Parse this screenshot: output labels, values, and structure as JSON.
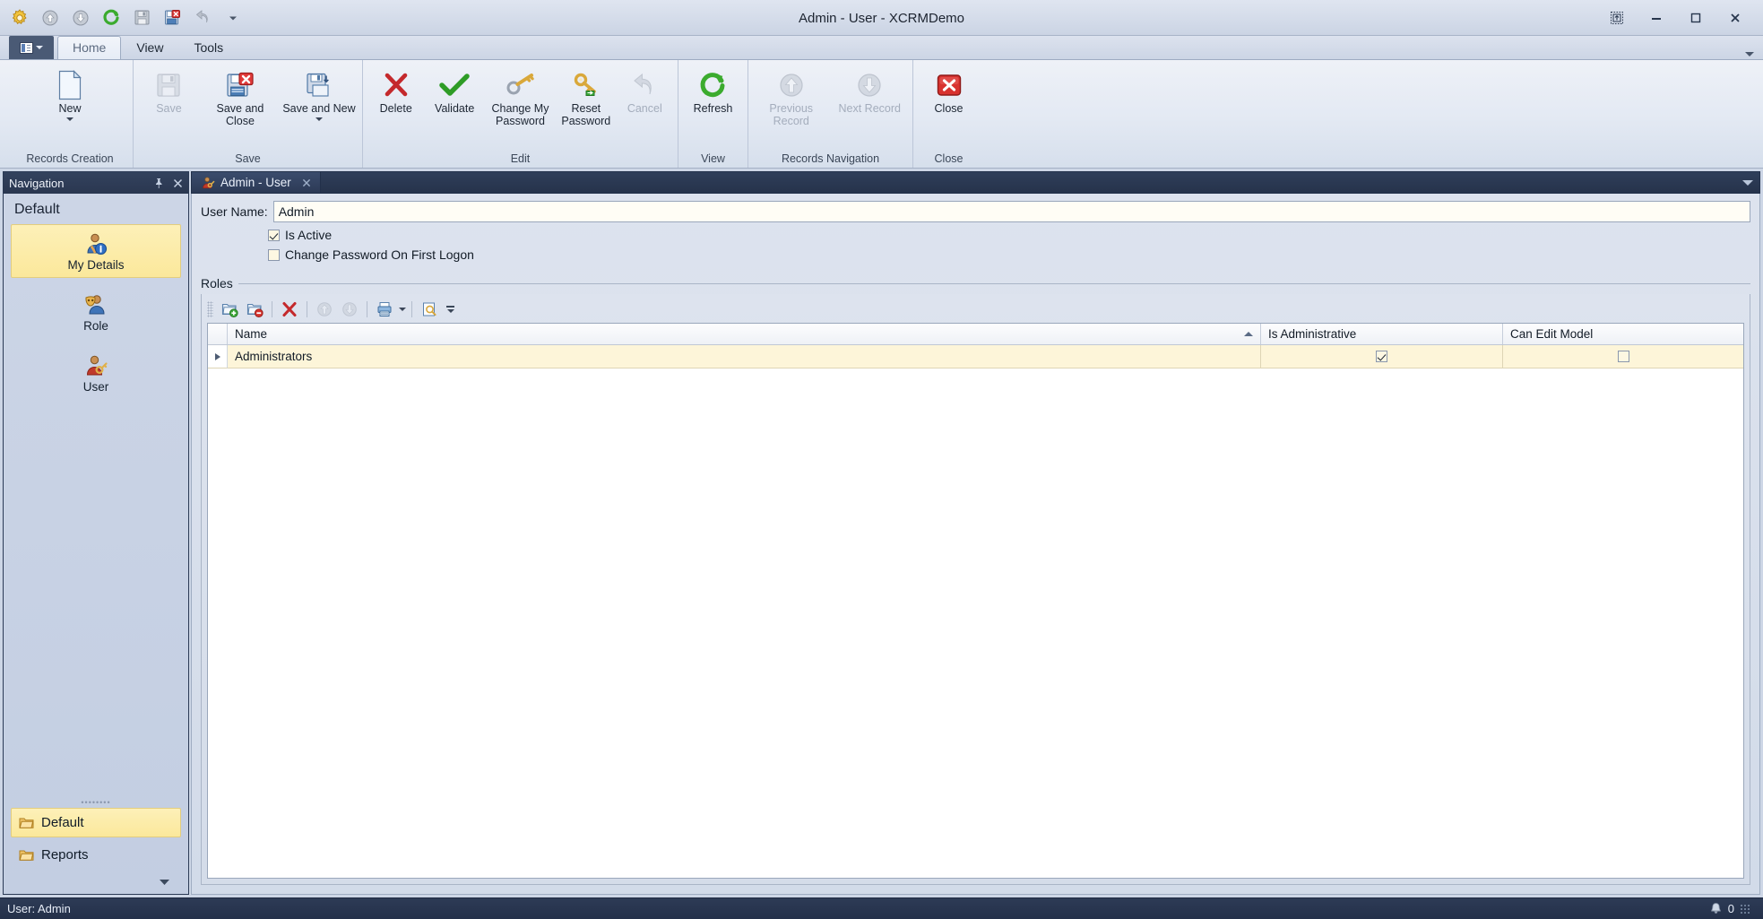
{
  "window": {
    "title": "Admin - User - XCRMDemo",
    "controls": {
      "restore_all": "restore-all",
      "minimize": "–",
      "maximize": "□",
      "close": "✕"
    }
  },
  "quick_access": [
    {
      "name": "settings-gear-icon",
      "label": "Options"
    },
    {
      "name": "up-circle-icon",
      "label": "Previous Record"
    },
    {
      "name": "down-circle-icon",
      "label": "Next Record"
    },
    {
      "name": "refresh-icon",
      "label": "Refresh"
    },
    {
      "name": "save-icon",
      "label": "Save"
    },
    {
      "name": "save-and-close-icon",
      "label": "Save and Close"
    },
    {
      "name": "undo-icon",
      "label": "Undo"
    },
    {
      "name": "qat-dropdown-icon",
      "label": "Customize Quick Access Toolbar"
    }
  ],
  "ribbon": {
    "app_menu_label": "",
    "tabs": [
      {
        "label": "Home",
        "active": true
      },
      {
        "label": "View",
        "active": false
      },
      {
        "label": "Tools",
        "active": false
      }
    ],
    "groups": [
      {
        "label": "Records Creation",
        "buttons": [
          {
            "label": "New",
            "icon": "new-document-icon",
            "disabled": false,
            "dropdown": true
          }
        ]
      },
      {
        "label": "Save",
        "buttons": [
          {
            "label": "Save",
            "icon": "floppy-disk-icon",
            "disabled": true,
            "dropdown": false
          },
          {
            "label": "Save and Close",
            "icon": "save-and-close-icon",
            "disabled": false,
            "dropdown": false
          },
          {
            "label": "Save and New",
            "icon": "save-and-new-icon",
            "disabled": false,
            "dropdown": true
          }
        ]
      },
      {
        "label": "Edit",
        "buttons": [
          {
            "label": "Delete",
            "icon": "red-x-icon",
            "disabled": false,
            "dropdown": false
          },
          {
            "label": "Validate",
            "icon": "green-check-icon",
            "disabled": false,
            "dropdown": false
          },
          {
            "label": "Change My Password",
            "icon": "key-icon",
            "disabled": false,
            "dropdown": false
          },
          {
            "label": "Reset Password",
            "icon": "key-reset-icon",
            "disabled": false,
            "dropdown": false
          },
          {
            "label": "Cancel",
            "icon": "undo-arrow-icon",
            "disabled": true,
            "dropdown": false
          }
        ]
      },
      {
        "label": "View",
        "buttons": [
          {
            "label": "Refresh",
            "icon": "refresh-circular-icon",
            "disabled": false,
            "dropdown": false
          }
        ]
      },
      {
        "label": "Records Navigation",
        "buttons": [
          {
            "label": "Previous Record",
            "icon": "up-arrow-circle-icon",
            "disabled": true,
            "dropdown": false
          },
          {
            "label": "Next Record",
            "icon": "down-arrow-circle-icon",
            "disabled": true,
            "dropdown": false
          }
        ]
      },
      {
        "label": "Close",
        "buttons": [
          {
            "label": "Close",
            "icon": "red-close-box-icon",
            "disabled": false,
            "dropdown": false
          }
        ]
      }
    ]
  },
  "navigation": {
    "title": "Navigation",
    "group_title": "Default",
    "items": [
      {
        "label": "My Details",
        "icon": "user-info-icon",
        "selected": true
      },
      {
        "label": "Role",
        "icon": "role-mask-icon",
        "selected": false
      },
      {
        "label": "User",
        "icon": "user-key-icon",
        "selected": false
      }
    ],
    "footer_items": [
      {
        "label": "Default",
        "icon": "folder-icon",
        "selected": true
      },
      {
        "label": "Reports",
        "icon": "folder-icon",
        "selected": false
      }
    ]
  },
  "document": {
    "tab": {
      "label": "Admin - User",
      "icon": "user-key-icon",
      "close": "✕"
    },
    "user_name": {
      "label": "User Name:",
      "value": "Admin",
      "placeholder": ""
    },
    "checkboxes": [
      {
        "label": "Is Active",
        "checked": true
      },
      {
        "label": "Change Password On First Logon",
        "checked": false
      }
    ],
    "roles": {
      "group_label": "Roles",
      "toolbar": [
        {
          "name": "new-role-icon",
          "label": "New",
          "disabled": false
        },
        {
          "name": "remove-role-icon",
          "label": "Remove",
          "disabled": false
        },
        {
          "name": "delete-icon",
          "label": "Delete",
          "disabled": false
        },
        {
          "name": "move-up-icon",
          "label": "Move Up",
          "disabled": true
        },
        {
          "name": "move-down-icon",
          "label": "Move Down",
          "disabled": true
        },
        {
          "name": "export-icon",
          "label": "Export",
          "disabled": false,
          "dropdown": true
        },
        {
          "name": "filter-icon",
          "label": "Filter",
          "disabled": false
        }
      ],
      "columns": [
        {
          "label": "Name",
          "sort": "asc"
        },
        {
          "label": "Is Administrative",
          "sort": ""
        },
        {
          "label": "Can Edit Model",
          "sort": ""
        }
      ],
      "rows": [
        {
          "name": "Administrators",
          "is_administrative": true,
          "can_edit_model": false,
          "current": true
        }
      ]
    }
  },
  "statusbar": {
    "user_text": "User: Admin",
    "notification_icon": "bell-icon",
    "notification_count": "0"
  }
}
